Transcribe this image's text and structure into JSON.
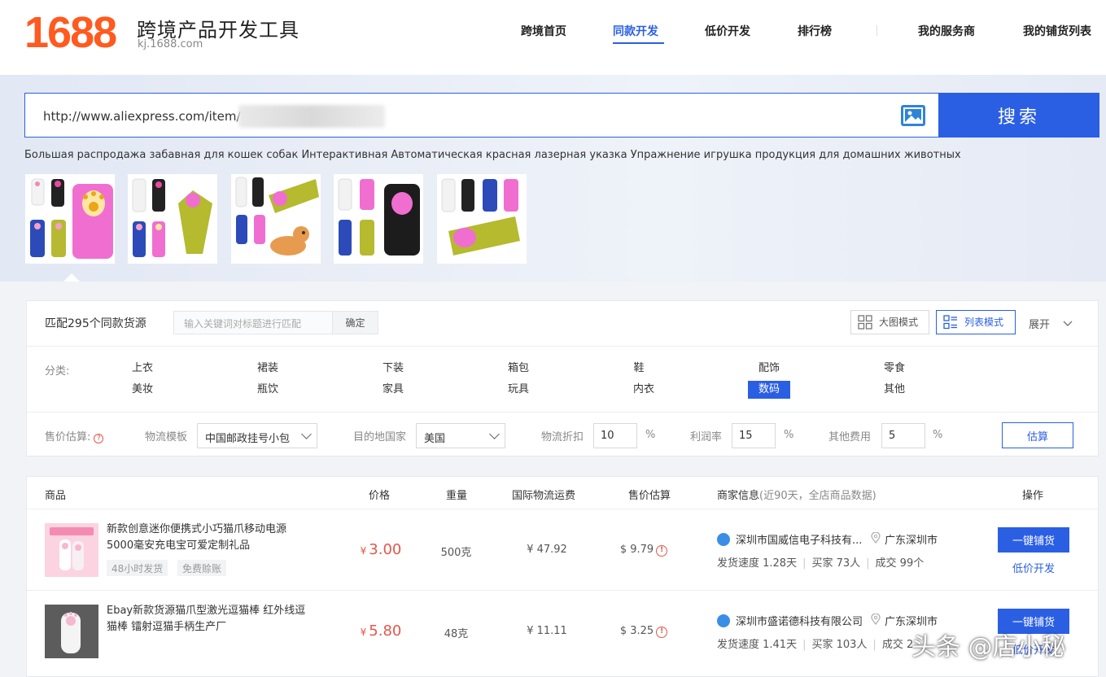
{
  "header": {
    "logo_text": "1688",
    "title": "跨境产品开发工具",
    "subtitle": "kj.1688.com",
    "nav": [
      {
        "label": "跨境首页"
      },
      {
        "label": "同款开发"
      },
      {
        "label": "低价开发"
      },
      {
        "label": "排行榜"
      },
      {
        "label": "我的服务商"
      },
      {
        "label": "我的铺货列表"
      }
    ],
    "active_nav": "同款开发"
  },
  "search": {
    "value": "http://www.aliexpress.com/item/",
    "button_label": "搜索",
    "image_search_icon": "image-icon"
  },
  "product_description": "Большая распродажа забавная для кошек собак Интерактивная Автоматическая красная лазерная указка Упражнение игрушка продукция для домашних животных",
  "thumbnails_count": 5,
  "filters": {
    "match_text": "匹配295个同款货源",
    "keyword_placeholder": "输入关键词对标题进行匹配",
    "confirm_label": "确定",
    "grid_mode_label": "大图模式",
    "list_mode_label": "列表模式",
    "expand_label": "展开",
    "category_label": "分类:",
    "categories": [
      "上衣",
      "裙装",
      "下装",
      "箱包",
      "鞋",
      "配饰",
      "零食",
      "美妆",
      "瓶饮",
      "家具",
      "玩具",
      "内衣",
      "数码",
      "其他"
    ],
    "active_category": "数码",
    "estimate": {
      "label": "售价估算:",
      "logistics_template_label": "物流模板",
      "logistics_template_value": "中国邮政挂号小包",
      "destination_label": "目的地国家",
      "destination_value": "美国",
      "discount_label": "物流折扣",
      "discount_value": "10",
      "profit_label": "利润率",
      "profit_value": "15",
      "other_label": "其他费用",
      "other_value": "5",
      "percent": "%",
      "button_label": "估算"
    }
  },
  "table": {
    "headers": {
      "product": "商品",
      "price": "价格",
      "weight": "重量",
      "shipping": "国际物流运费",
      "sell": "售价估算",
      "seller": "商家信息",
      "seller_note": "(近90天，全店商品数据)",
      "action": "操作"
    },
    "rows": [
      {
        "title": "新款创意迷你便携式小巧猫爪移动电源5000毫安充电宝可爱定制礼品",
        "tags": [
          "48小时发货",
          "免费赊账"
        ],
        "price": "3.00",
        "weight": "500克",
        "shipping": "¥ 47.92",
        "sell": "$ 9.79",
        "seller": "深圳市国威信电子科技有...",
        "location": "广东深圳市",
        "speed": "发货速度 1.28天",
        "buyers": "买家 73人",
        "deals": "成交 99个",
        "action": "一键铺货",
        "link": "低价开发"
      },
      {
        "title": "Ebay新款货源猫爪型激光逗猫棒 红外线逗猫棒 镭射逗猫手柄生产厂",
        "tags": [],
        "price": "5.80",
        "weight": "48克",
        "shipping": "¥ 11.11",
        "sell": "$ 3.25",
        "seller": "深圳市盛诺德科技有限公司",
        "location": "广东深圳市",
        "speed": "发货速度 1.41天",
        "buyers": "买家 103人",
        "deals": "成交 2",
        "action": "一键铺货",
        "link": "低价开发"
      }
    ],
    "currency_symbol": "¥"
  },
  "watermark": "头条 @店小秘",
  "colors": {
    "accent": "#2b5fe3",
    "brand": "#ff5a1f",
    "price": "#e2574c"
  }
}
